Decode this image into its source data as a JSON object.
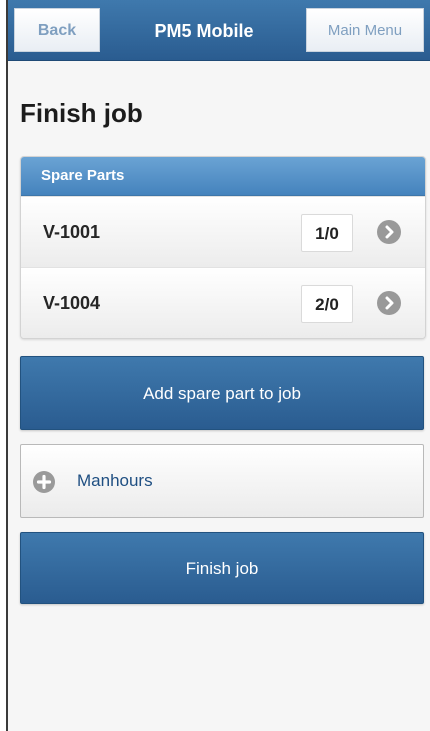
{
  "header": {
    "back_label": "Back",
    "title": "PM5 Mobile",
    "menu_label": "Main Menu"
  },
  "page": {
    "title": "Finish job"
  },
  "spare_parts": {
    "heading": "Spare Parts",
    "items": [
      {
        "name": "V-1001",
        "count": "1/0"
      },
      {
        "name": "V-1004",
        "count": "2/0"
      }
    ]
  },
  "actions": {
    "add_spare_part_label": "Add spare part to job",
    "manhours_label": "Manhours",
    "finish_job_label": "Finish job"
  },
  "icons": {
    "item_chevron": "chevron-right-icon",
    "manhours_expand": "plus-icon"
  },
  "colors": {
    "header_blue": "#2f6599",
    "list_divider_blue": "#5592c8",
    "link_blue": "#1f4f82"
  }
}
